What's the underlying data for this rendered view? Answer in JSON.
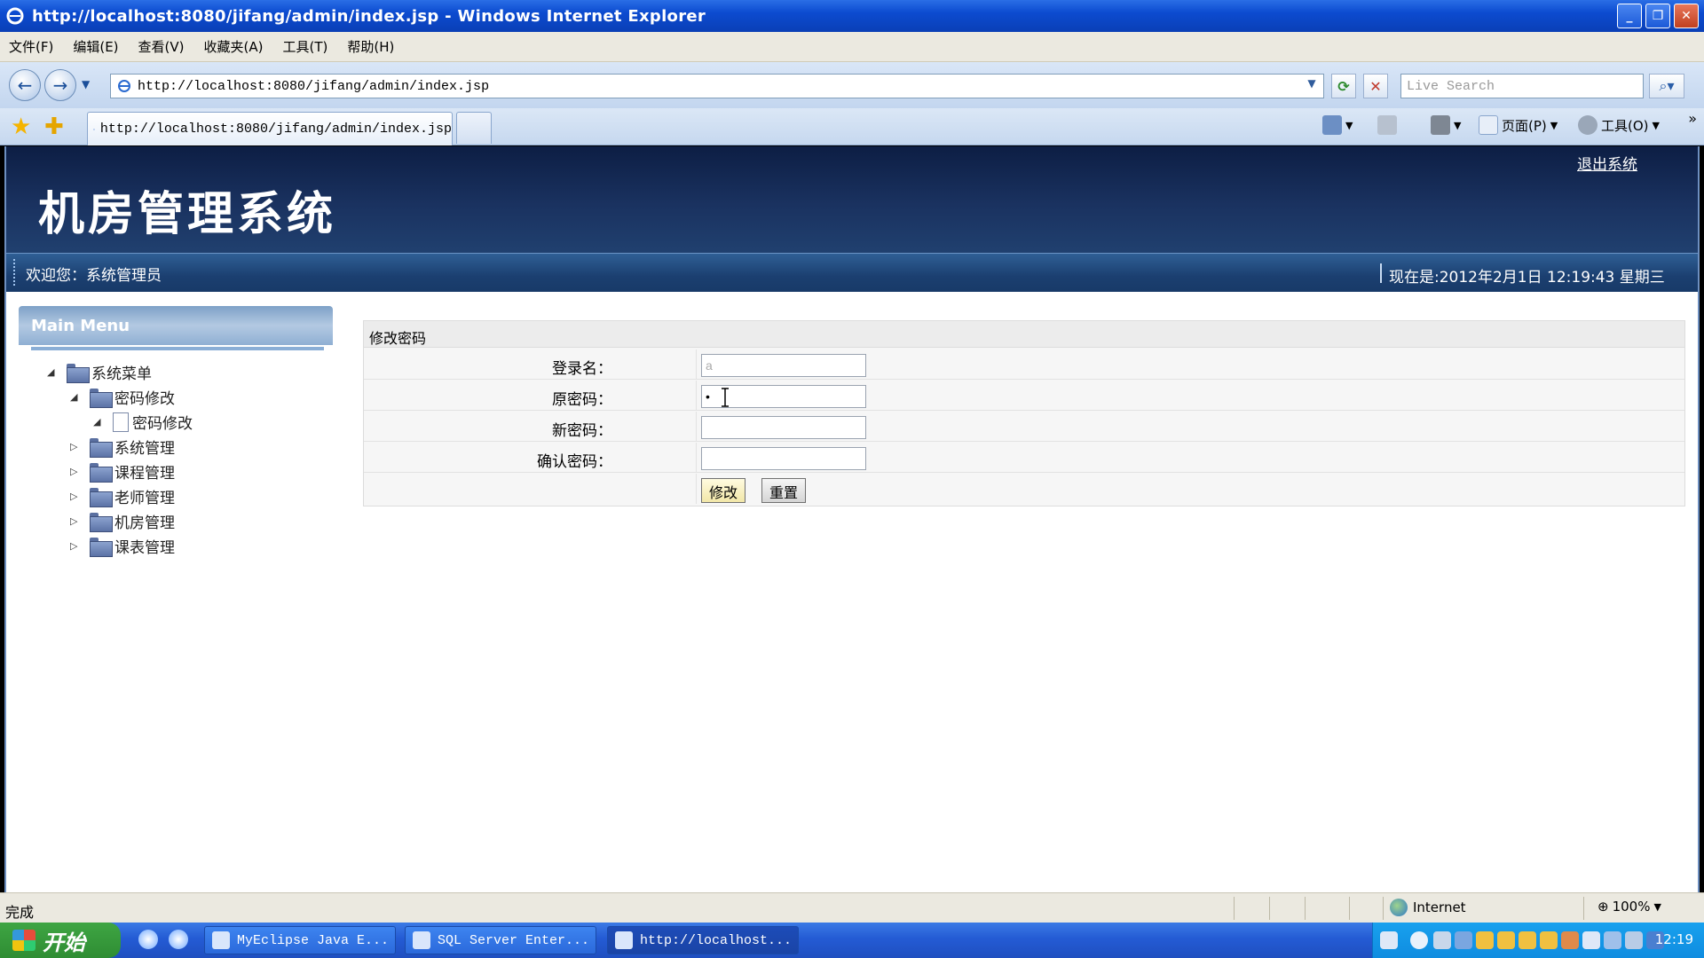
{
  "window": {
    "title": "http://localhost:8080/jifang/admin/index.jsp - Windows Internet Explorer"
  },
  "menubar": [
    "文件(F)",
    "编辑(E)",
    "查看(V)",
    "收藏夹(A)",
    "工具(T)",
    "帮助(H)"
  ],
  "addressbar": {
    "url": "http://localhost:8080/jifang/admin/index.jsp",
    "search_placeholder": "Live Search"
  },
  "tab": {
    "label": "http://localhost:8080/jifang/admin/index.jsp"
  },
  "commandbar": {
    "page_label": "页面(P)",
    "tools_label": "工具(O)"
  },
  "page": {
    "system_title": "机房管理系统",
    "logout_label": "退出系统",
    "welcome_text": "欢迎您：系统管理员",
    "datetime_text": "现在是:2012年2月1日  12:19:43 星期三",
    "main_menu_label": "Main Menu",
    "tree": {
      "root": "系统菜单",
      "password_group": "密码修改",
      "password_item": "密码修改",
      "items": [
        "系统管理",
        "课程管理",
        "老师管理",
        "机房管理",
        "课表管理"
      ]
    },
    "form": {
      "title": "修改密码",
      "login_label": "登录名：",
      "login_value": "a",
      "old_password_label": "原密码：",
      "old_password_value": "•",
      "new_password_label": "新密码：",
      "confirm_password_label": "确认密码：",
      "submit_label": "修改",
      "reset_label": "重置"
    }
  },
  "statusbar": {
    "status_text": "完成",
    "zone_text": "Internet",
    "zoom_text": "100%"
  },
  "taskbar": {
    "start_label": "开始",
    "tasks": [
      "MyEclipse Java E...",
      "SQL Server Enter...",
      "http://localhost..."
    ],
    "clock": "12:19"
  }
}
